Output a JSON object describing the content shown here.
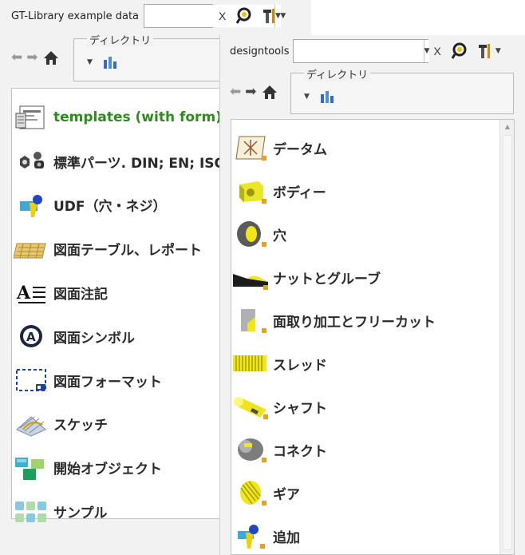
{
  "back_panel": {
    "title": "GT-Library example data",
    "search_value": "",
    "clear_label": "X",
    "directory_label": "ディレクトリ",
    "items": [
      {
        "label": "templates (with form)",
        "icon": "form-template-icon",
        "color": "#2e8b1e"
      },
      {
        "label": "標準パーツ. DIN; EN; ISO",
        "icon": "standard-parts-icon"
      },
      {
        "label": "UDF（穴・ネジ）",
        "icon": "udf-icon"
      },
      {
        "label": "図面テーブル、レポート",
        "icon": "drawing-table-icon"
      },
      {
        "label": "図面注記",
        "icon": "drawing-note-icon"
      },
      {
        "label": "図面シンボル",
        "icon": "drawing-symbol-icon"
      },
      {
        "label": "図面フォーマット",
        "icon": "drawing-format-icon"
      },
      {
        "label": "スケッチ",
        "icon": "sketch-icon"
      },
      {
        "label": "開始オブジェクト",
        "icon": "start-object-icon"
      },
      {
        "label": "サンプル",
        "icon": "sample-icon"
      }
    ]
  },
  "front_panel": {
    "title": "designtools",
    "search_value": "",
    "clear_label": "X",
    "directory_label": "ディレクトリ",
    "items": [
      {
        "label": "データム",
        "icon": "datum-icon"
      },
      {
        "label": "ボディー",
        "icon": "body-icon"
      },
      {
        "label": "穴",
        "icon": "hole-icon"
      },
      {
        "label": "ナットとグルーブ",
        "icon": "nut-groove-icon"
      },
      {
        "label": "面取り加工とフリーカット",
        "icon": "chamfer-icon"
      },
      {
        "label": "スレッド",
        "icon": "thread-icon"
      },
      {
        "label": "シャフト",
        "icon": "shaft-icon"
      },
      {
        "label": "コネクト",
        "icon": "connect-icon"
      },
      {
        "label": "ギア",
        "icon": "gear-icon"
      },
      {
        "label": "追加",
        "icon": "add-icon"
      }
    ]
  }
}
